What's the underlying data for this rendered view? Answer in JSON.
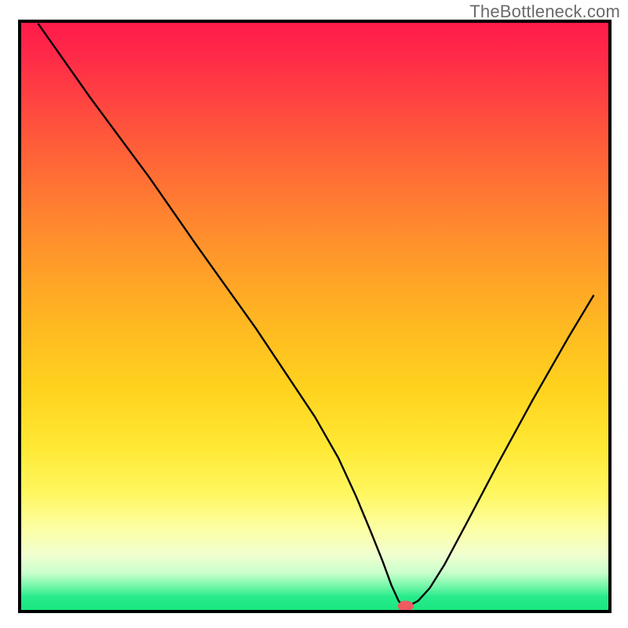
{
  "watermark": "TheBottleneck.com",
  "chart_data": {
    "type": "line",
    "title": "",
    "xlabel": "",
    "ylabel": "",
    "xlim": [
      0,
      100
    ],
    "ylim": [
      0,
      100
    ],
    "grid": false,
    "gradient_stops": [
      {
        "offset": 0.0,
        "color": "#ff1a4a"
      },
      {
        "offset": 0.06,
        "color": "#ff2a48"
      },
      {
        "offset": 0.2,
        "color": "#ff5a3a"
      },
      {
        "offset": 0.35,
        "color": "#ff8a2e"
      },
      {
        "offset": 0.5,
        "color": "#ffb522"
      },
      {
        "offset": 0.62,
        "color": "#ffd21e"
      },
      {
        "offset": 0.72,
        "color": "#ffe833"
      },
      {
        "offset": 0.8,
        "color": "#fff760"
      },
      {
        "offset": 0.86,
        "color": "#fcffa5"
      },
      {
        "offset": 0.905,
        "color": "#f0ffd0"
      },
      {
        "offset": 0.935,
        "color": "#c9ffcc"
      },
      {
        "offset": 0.958,
        "color": "#70f7a8"
      },
      {
        "offset": 0.975,
        "color": "#28eb8b"
      },
      {
        "offset": 1.0,
        "color": "#17e77f"
      }
    ],
    "series": [
      {
        "name": "bottleneck-curve",
        "x": [
          3.2,
          12,
          22,
          30,
          35,
          40,
          45,
          50,
          54,
          57,
          59.5,
          61.5,
          63,
          64.2,
          65.0,
          65.8,
          67.5,
          69.5,
          72,
          76,
          81,
          87,
          93,
          97.2
        ],
        "y": [
          99.5,
          87,
          73.5,
          62,
          55,
          48,
          40.5,
          33,
          26,
          19.5,
          13.5,
          8.5,
          4.4,
          1.8,
          0.9,
          0.9,
          1.8,
          4.0,
          8.0,
          15.5,
          25,
          36,
          46.5,
          53.5
        ]
      }
    ],
    "marker": {
      "x": 65.4,
      "y": 0.9,
      "color": "#ef5a62",
      "rx": 10,
      "ry": 7
    },
    "frame": {
      "inner_x": 25,
      "inner_y": 27,
      "inner_w": 752,
      "inner_h": 752,
      "stroke": "#000000",
      "stroke_width": 4
    }
  }
}
